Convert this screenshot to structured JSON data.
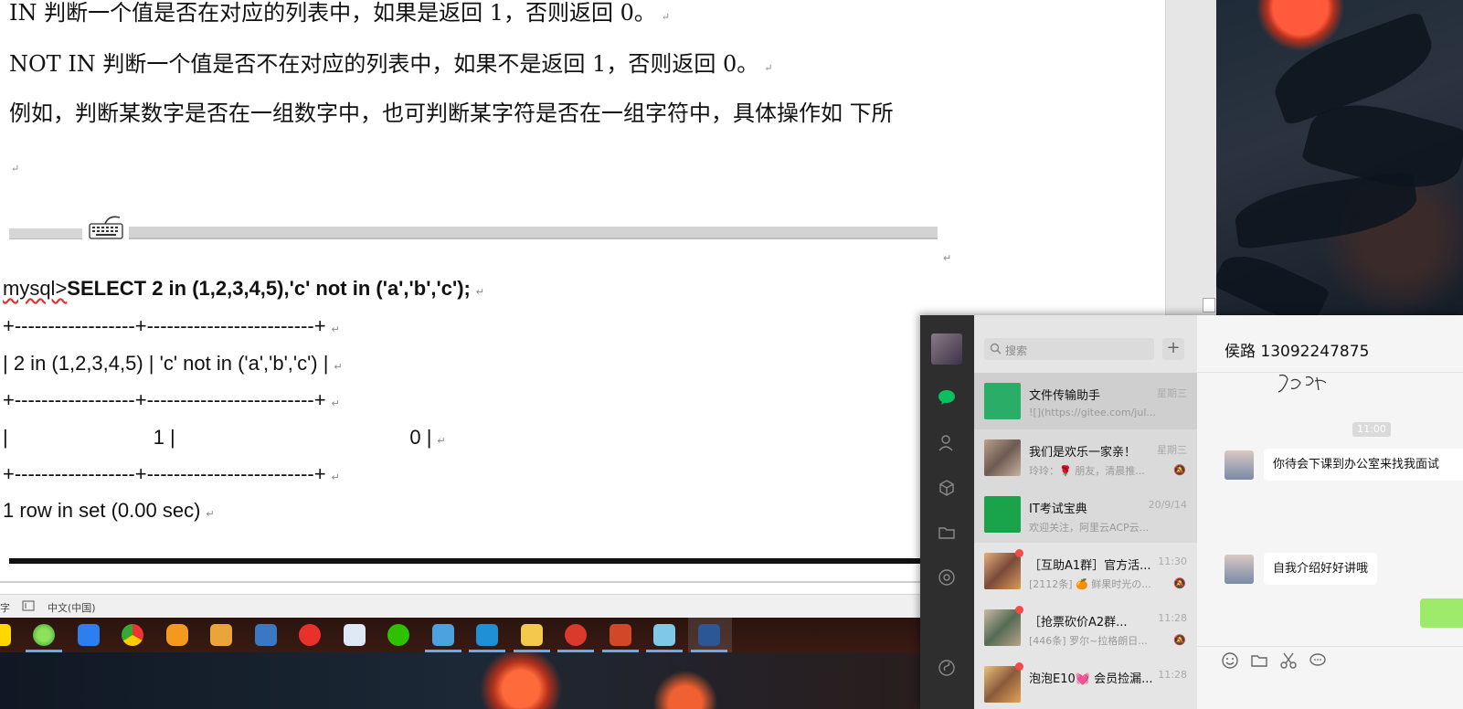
{
  "document": {
    "line_in": "IN 判断一个值是否在对应的列表中，如果是返回  1，否则返回  0。",
    "line_not_in": "NOT IN 判断一个值是否不在对应的列表中，如果不是返回  1，否则返回  0。",
    "line_example": "例如，判断某数字是否在一组数字中，也可判断某字符是否在一组字符中，具体操作如    下所",
    "code_prompt": "mysql>",
    "code_query": "SELECT 2 in (1,2,3,4,5),'c' not in ('a','b','c');",
    "code_border_1": "+------------------+-------------------------+",
    "code_header": "| 2 in (1,2,3,4,5) | 'c' not in ('a','b','c') |",
    "code_border_2": "+------------------+-------------------------+",
    "code_row": "|                          1 |                                          0 |",
    "code_border_3": "+------------------+-------------------------+",
    "code_footer": "1 row in set (0.00 sec)",
    "paragraph_mark": "↵"
  },
  "statusbar": {
    "word_fragment": "字",
    "language": "中文(中国)"
  },
  "taskbar": {
    "icons": [
      "windows-start-icon",
      "360-browser-icon",
      "feishu-icon",
      "chrome-icon",
      "qq-music-icon",
      "file-manager-icon",
      "git-icon",
      "red-app-icon",
      "mail-icon",
      "wechat-icon",
      "remote-desktop-icon",
      "vmware-icon",
      "folder-icon",
      "snail-app-icon",
      "powerpoint-icon",
      "notes-icon",
      "word-icon"
    ]
  },
  "wechat": {
    "search_placeholder": "搜索",
    "add_button": "+",
    "chats": [
      {
        "name": "文件传输助手",
        "preview": "![](https://gitee.com/jul...",
        "time": "星期三",
        "muted": false,
        "unread": false
      },
      {
        "name": "我们是欢乐一家亲！",
        "preview": "玲玲：🌹 朋友，清晨推...",
        "time": "星期三",
        "muted": true,
        "unread": false
      },
      {
        "name": "IT考试宝典",
        "preview": "欢迎关注，阿里云ACP云...",
        "time": "20/9/14",
        "muted": false,
        "unread": false
      },
      {
        "name": "［互助A1群］官方活...",
        "preview": "[2112条] 🍊 鲜果时光の...",
        "time": "11:30",
        "muted": true,
        "unread": true
      },
      {
        "name": "［抢票砍价A2群...",
        "preview": "[446条] 罗尔~拉格朗日...",
        "time": "11:28",
        "muted": true,
        "unread": true
      },
      {
        "name": "泡泡E10💓 会员捡漏...",
        "preview": "",
        "time": "11:28",
        "muted": false,
        "unread": true
      }
    ],
    "chat_title": "侯路 13092247875",
    "time_pill": "11:00",
    "messages": [
      {
        "text": "你待会下课到办公室来找我面试"
      },
      {
        "text": "自我介绍好好讲哦"
      }
    ]
  },
  "colors": {
    "wechat_green": "#07c160",
    "unread_red": "#f54a45",
    "bubble_green": "#9eea6a"
  }
}
